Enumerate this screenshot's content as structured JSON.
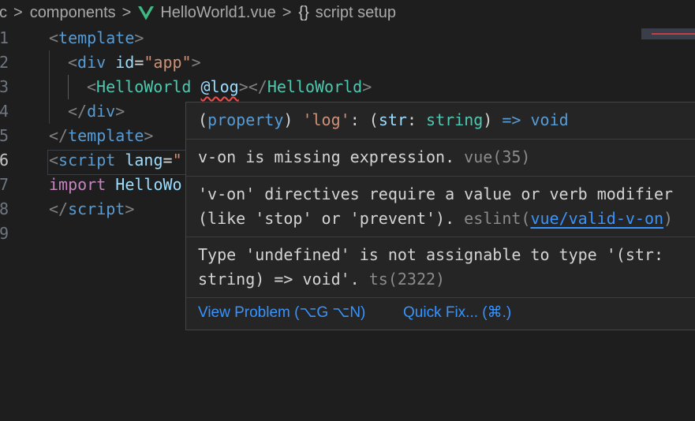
{
  "breadcrumb": {
    "part1": "c",
    "part2": "components",
    "file": "HelloWorld1.vue",
    "symbol_icon": "{}",
    "symbol": "script setup",
    "separator": ">"
  },
  "editor": {
    "line_numbers": [
      "1",
      "2",
      "3",
      "4",
      "5",
      "6",
      "7",
      "8",
      "9"
    ],
    "active_line": "6",
    "lines": {
      "l1": {
        "open": "<",
        "tag": "template",
        "close": ">"
      },
      "l2": {
        "open": "<",
        "tag": "div",
        "sp": " ",
        "attr": "id",
        "eq": "=",
        "val": "\"app\"",
        "close": ">"
      },
      "l3": {
        "open": "<",
        "comp": "HelloWorld",
        "sp": " ",
        "event": "@log",
        "mid": "></",
        "comp2": "HelloWorld",
        "close": ">"
      },
      "l4": {
        "open": "</",
        "tag": "div",
        "close": ">"
      },
      "l5": {
        "open": "</",
        "tag": "template",
        "close": ">"
      },
      "l6": {
        "open": "<",
        "tag": "script",
        "sp": " ",
        "attr": "lang",
        "eq": "=",
        "val": "\""
      },
      "l7": {
        "kw": "import",
        "sp": " ",
        "ident": "HelloWo"
      },
      "l8": {
        "open": "</",
        "tag": "script",
        "close": ">"
      }
    }
  },
  "hover": {
    "signature": {
      "paren_open": "(",
      "kind": "property",
      "paren_close": ")",
      "name": "'log'",
      "colon": ":",
      "params_open": " (",
      "param": "str",
      "param_colon": ": ",
      "param_type": "string",
      "params_close": ")",
      "arrow": " => ",
      "ret": "void"
    },
    "problems": [
      {
        "text": "v-on is missing expression.",
        "source": "vue(35)"
      },
      {
        "line1": "'v-on' directives require a value or verb modifier",
        "line2": "(like 'stop' or 'prevent').",
        "source_prefix": "eslint(",
        "source_link": "vue/valid-v-on",
        "source_suffix": ")"
      },
      {
        "line1": "Type 'undefined' is not assignable to type '(str:",
        "line2": "string) => void'.",
        "source": "ts(2322)"
      }
    ],
    "actions": {
      "view_problem": "View Problem (⌥G ⌥N)",
      "quick_fix": "Quick Fix... (⌘.)"
    }
  },
  "colors": {
    "background": "#1e1e1e",
    "hover_bg": "#252526",
    "link": "#3794ff",
    "error": "#f14c4c"
  }
}
